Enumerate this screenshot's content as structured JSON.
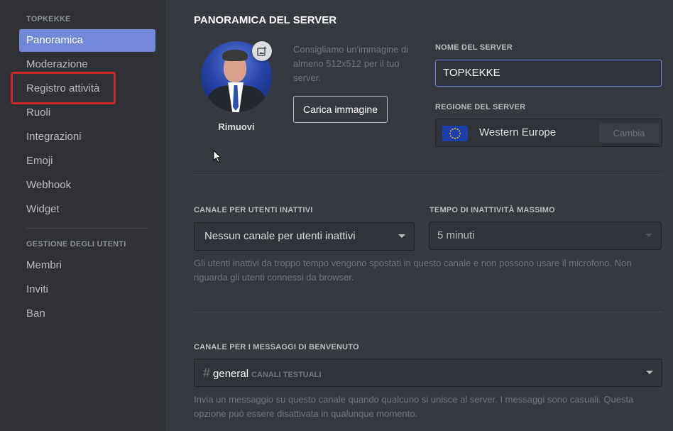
{
  "sidebar": {
    "server_header": "TOPKEKKE",
    "items": [
      {
        "label": "Panoramica",
        "active": true
      },
      {
        "label": "Moderazione"
      },
      {
        "label": "Registro attività"
      },
      {
        "label": "Ruoli"
      },
      {
        "label": "Integrazioni"
      },
      {
        "label": "Emoji"
      },
      {
        "label": "Webhook"
      },
      {
        "label": "Widget"
      }
    ],
    "users_header": "GESTIONE DEGLI UTENTI",
    "user_items": [
      {
        "label": "Membri"
      },
      {
        "label": "Inviti"
      },
      {
        "label": "Ban"
      }
    ]
  },
  "overview": {
    "title": "PANORAMICA DEL SERVER",
    "remove_label": "Rimuovi",
    "recommendation": "Consigliamo un'immagine di almeno 512x512 per il tuo server.",
    "upload_button": "Carica immagine",
    "server_name_label": "NOME DEL SERVER",
    "server_name_value": "TOPKEKKE",
    "region_label": "REGIONE DEL SERVER",
    "region_name": "Western Europe",
    "region_flag": "eu-flag",
    "change_button": "Cambia"
  },
  "afk": {
    "channel_label": "CANALE PER UTENTI INATTIVI",
    "channel_value": "Nessun canale per utenti inattivi",
    "timeout_label": "TEMPO DI INATTIVITÀ MASSIMO",
    "timeout_value": "5 minuti",
    "help": "Gli utenti inattivi da troppo tempo vengono spostati in questo canale e non possono usare il microfono. Non riguarda gli utenti connessi da browser."
  },
  "welcome": {
    "label": "CANALE PER I MESSAGGI DI BENVENUTO",
    "channel_name": "general",
    "channel_category": "CANALI TESTUALI",
    "help": "Invia un messaggio su questo canale quando qualcuno si unisce al server. I messaggi sono casuali. Questa opzione può essere disattivata in qualunque momento."
  },
  "colors": {
    "accent": "#7289da",
    "sidebar_bg": "#2f3136",
    "main_bg": "#36393f",
    "highlight": "#d0272d"
  }
}
